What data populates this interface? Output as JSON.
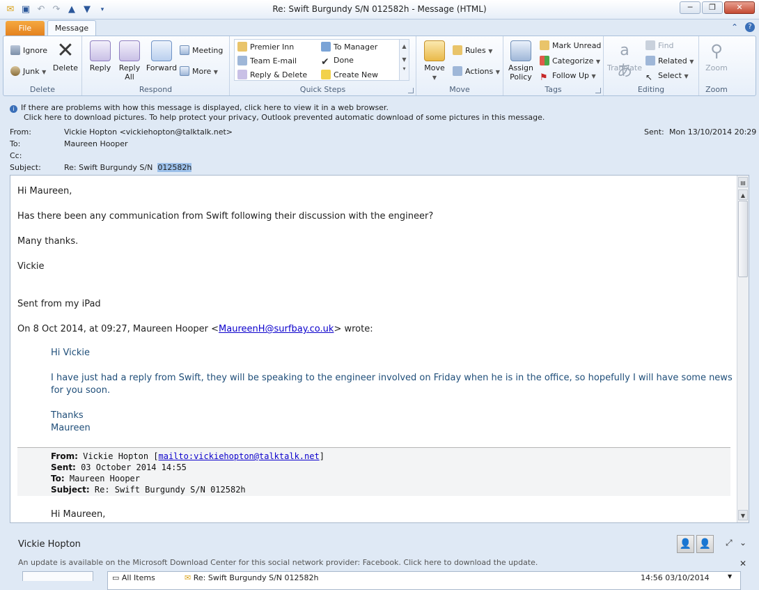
{
  "window": {
    "title": "Re: Swift Burgundy S/N  012582h  -  Message (HTML)",
    "minimize": "─",
    "maximize": "❐",
    "close": "✕"
  },
  "tabs": {
    "file": "File",
    "message": "Message"
  },
  "ribbon": {
    "delete": {
      "label": "Delete",
      "ignore": "Ignore",
      "junk": "Junk",
      "delete_btn": "Delete"
    },
    "respond": {
      "label": "Respond",
      "reply": "Reply",
      "reply_all": "Reply All",
      "forward": "Forward",
      "meeting": "Meeting",
      "more": "More"
    },
    "quick_steps": {
      "label": "Quick Steps",
      "items": [
        "Premier Inn",
        "To Manager",
        "Team E-mail",
        "Done",
        "Reply & Delete",
        "Create New"
      ]
    },
    "move": {
      "label": "Move",
      "move_btn": "Move",
      "rules": "Rules",
      "actions": "Actions"
    },
    "tags": {
      "label": "Tags",
      "assign_policy": "Assign Policy",
      "mark_unread": "Mark Unread",
      "categorize": "Categorize",
      "follow_up": "Follow Up"
    },
    "editing": {
      "label": "Editing",
      "translate": "Translate",
      "find": "Find",
      "related": "Related",
      "select": "Select"
    },
    "zoom": {
      "label": "Zoom",
      "zoom_btn": "Zoom"
    }
  },
  "infobar": {
    "line1": "If there are problems with how this message is displayed, click here to view it in a web browser.",
    "line2": "Click here to download pictures. To help protect your privacy, Outlook prevented automatic download of some pictures in this message."
  },
  "header": {
    "from_label": "From:",
    "from": "Vickie Hopton <vickiehopton@talktalk.net>",
    "to_label": "To:",
    "to": "Maureen Hooper",
    "cc_label": "Cc:",
    "cc": "",
    "subject_label": "Subject:",
    "subject": "Re: Swift Burgundy S/N ",
    "subject_sel": "012582h",
    "sent_label": "Sent:",
    "sent": "Mon 13/10/2014 20:29"
  },
  "body": {
    "greeting": "Hi Maureen,",
    "question": "Has there been any communication from Swift following their discussion with the engineer?",
    "thanks": "Many thanks.",
    "sign": "Vickie",
    "ipad": "Sent from my iPad",
    "on_prefix": "On 8 Oct 2014, at 09:27, Maureen Hooper <",
    "on_email": "MaureenH@surfbay.co.uk",
    "on_suffix": "> wrote:",
    "q_greeting": "Hi Vickie",
    "q_line1": "I have just had a reply from Swift, they will be speaking to the engineer involved on Friday when he is in the office, so hopefully I will have some news",
    "q_line2": "for you soon.",
    "q_thanks": "Thanks",
    "q_sign": "Maureen",
    "fwd_from_label": "From:",
    "fwd_from": " Vickie Hopton [",
    "fwd_mailto": "mailto:vickiehopton@talktalk.net",
    "fwd_from_end": "]",
    "fwd_sent_label": "Sent:",
    "fwd_sent": " 03 October 2014 14:55",
    "fwd_to_label": "To:",
    "fwd_to": " Maureen Hooper",
    "fwd_subject_label": "Subject:",
    "fwd_subject": " Re: Swift Burgundy S/N 012582h",
    "next_greeting": "Hi Maureen,"
  },
  "people_pane": {
    "name": "Vickie Hopton",
    "update": "An update is available on the Microsoft Download Center for this social network provider: Facebook. Click here to download the update.",
    "all_items": "All Items",
    "item_subject": "Re: Swift Burgundy S/N 012582h",
    "item_time": "14:56  03/10/2014"
  }
}
